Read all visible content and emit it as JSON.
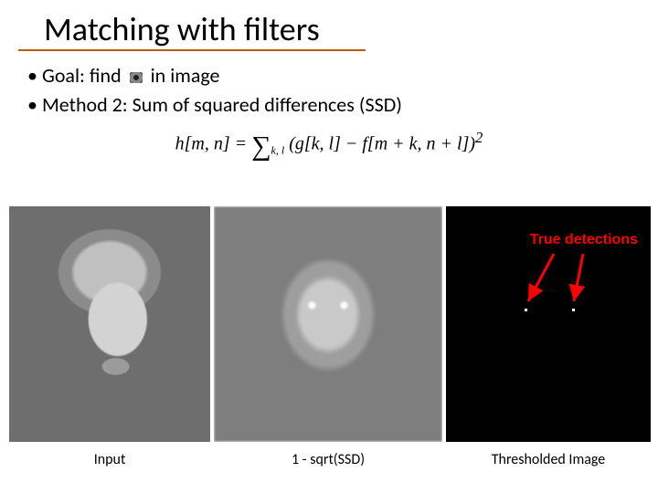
{
  "title": "Matching with filters",
  "bullets": {
    "goal_prefix": "Goal: find",
    "goal_suffix": "in image",
    "method": "Method 2: Sum of squared differences (SSD)"
  },
  "formula": {
    "lhs": "h[m, n] = ",
    "sum_sub": "k, l",
    "body_a": "(g[k, l] − f[m + k, n + l])",
    "sup": "2"
  },
  "panels": {
    "input_caption": "Input",
    "ssd_caption": "1 - sqrt(SSD)",
    "thr_caption": "Thresholded Image",
    "true_detections": "True detections"
  }
}
